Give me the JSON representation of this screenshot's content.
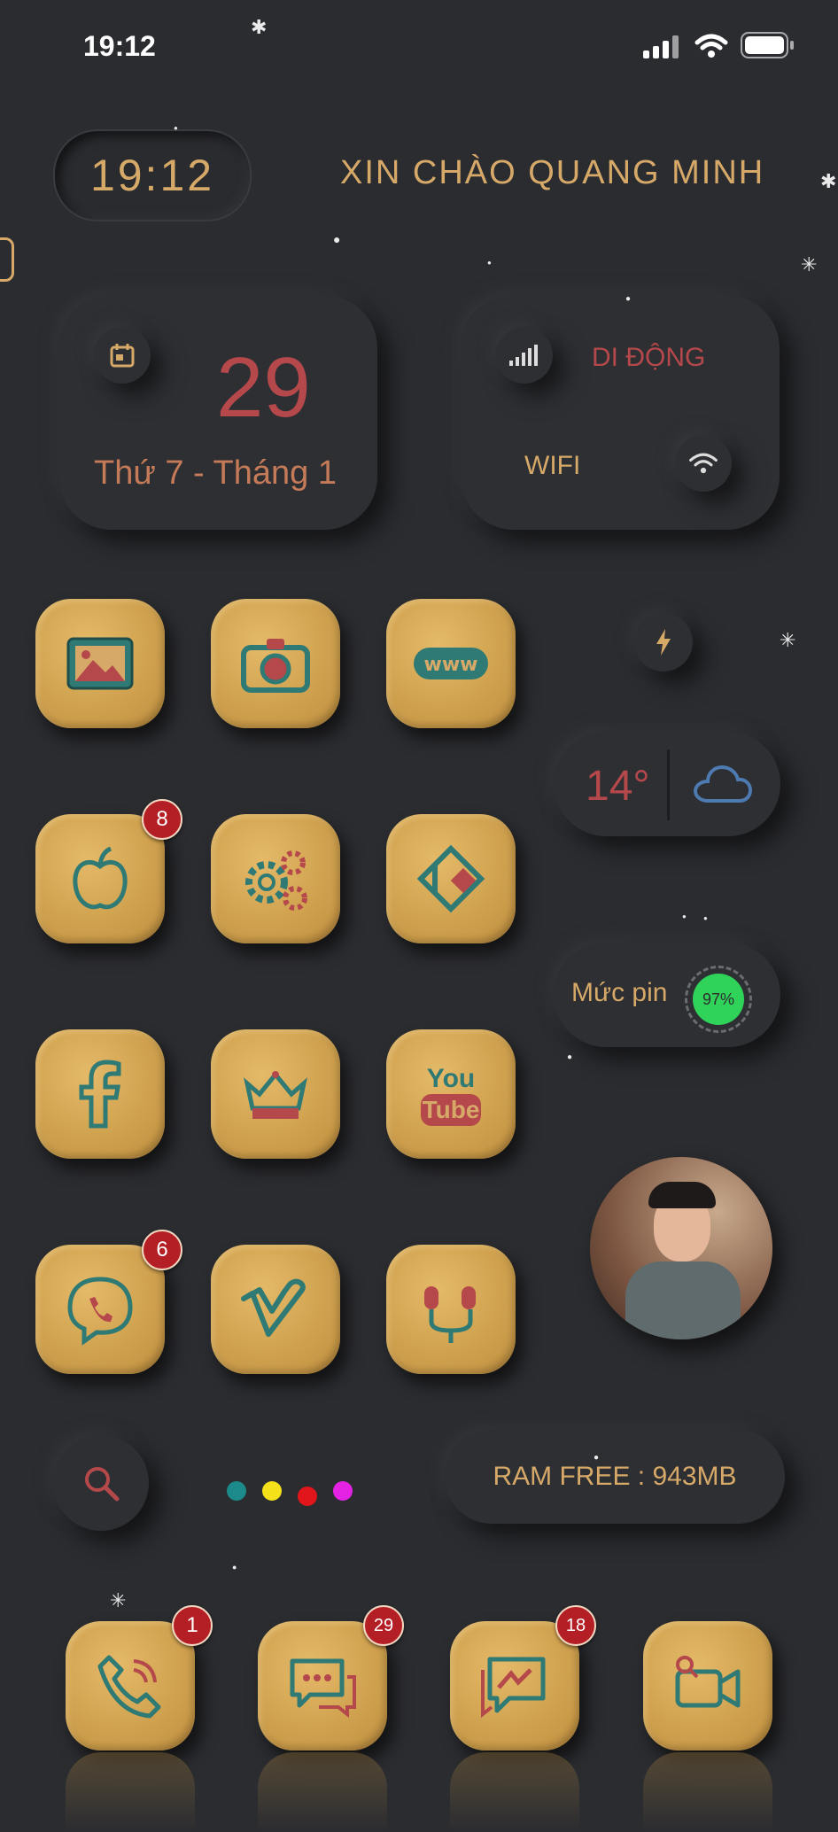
{
  "status_bar": {
    "time": "19:12"
  },
  "header": {
    "clock": "19:12",
    "greeting": "XIN CHÀO QUANG MINH"
  },
  "date_widget": {
    "day": "29",
    "date_text": "Thứ 7 - Tháng 1"
  },
  "network_widget": {
    "mobile_label": "DI ĐỘNG",
    "wifi_label": "WIFI"
  },
  "weather": {
    "temperature": "14°"
  },
  "battery": {
    "label": "Mức pin",
    "percent_text": "97%",
    "level": 0.97
  },
  "ram": {
    "text": "RAM FREE : 943MB"
  },
  "apps": [
    {
      "name": "photos-app",
      "icon": "photo-icon",
      "badge": ""
    },
    {
      "name": "camera-app",
      "icon": "camera-icon",
      "badge": ""
    },
    {
      "name": "browser-app",
      "icon": "www-icon",
      "badge": ""
    },
    {
      "name": "app-store-app",
      "icon": "apple-icon",
      "badge": "8"
    },
    {
      "name": "settings-app",
      "icon": "gears-icon",
      "badge": ""
    },
    {
      "name": "kodi-app",
      "icon": "kodi-icon",
      "badge": ""
    },
    {
      "name": "facebook-app",
      "icon": "facebook-icon",
      "badge": ""
    },
    {
      "name": "crown-app",
      "icon": "crown-icon",
      "badge": ""
    },
    {
      "name": "youtube-app",
      "icon": "youtube-icon",
      "badge": ""
    },
    {
      "name": "viber-app",
      "icon": "viber-icon",
      "badge": "6"
    },
    {
      "name": "vimeo-app",
      "icon": "vimeo-icon",
      "badge": ""
    },
    {
      "name": "music-app",
      "icon": "earphones-icon",
      "badge": ""
    }
  ],
  "youtube_text": {
    "top": "You",
    "bottom": "Tube"
  },
  "browser_text": "www",
  "dock": [
    {
      "name": "phone-app",
      "icon": "phone-icon",
      "badge": "1"
    },
    {
      "name": "messages-app",
      "icon": "chat-icon",
      "badge": "29"
    },
    {
      "name": "messenger-app",
      "icon": "messenger-icon",
      "badge": "18"
    },
    {
      "name": "facetime-app",
      "icon": "video-icon",
      "badge": ""
    }
  ],
  "page_dots": [
    "#1c8a8a",
    "#f5e11a",
    "#e0161b",
    "#e322e3"
  ],
  "colors": {
    "gold": "#d6a968",
    "red": "#b4484b",
    "teal": "#2f7a74",
    "background": "#2b2c30"
  }
}
